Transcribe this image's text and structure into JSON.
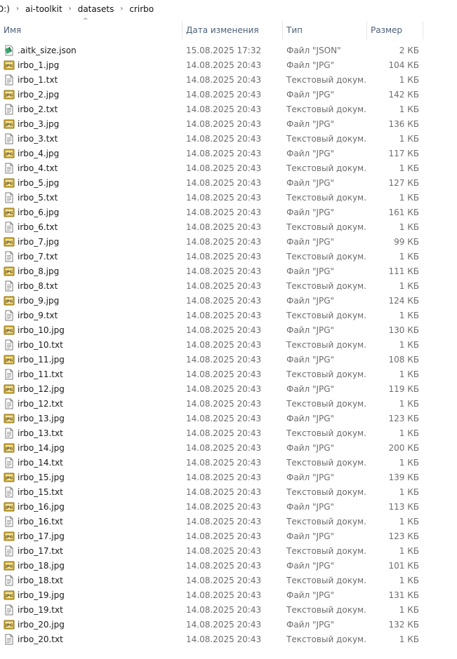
{
  "breadcrumb": {
    "items": [
      "D:)",
      "ai-toolkit",
      "datasets",
      "crirbo"
    ],
    "separator": "›"
  },
  "columns": {
    "name": "Имя",
    "date": "Дата изменения",
    "type": "Тип",
    "size": "Размер",
    "sort_indicator": "^"
  },
  "colors": {
    "header_text": "#4c607a",
    "detail_text": "#6d6d6d",
    "jpg_icon_bg": "#c8a628",
    "json_icon": "#3aa76d"
  },
  "files": [
    {
      "name": ".aitk_size.json",
      "date": "15.08.2025 17:32",
      "type": "Файл \"JSON\"",
      "size": "2 КБ",
      "icon": "json-file-icon"
    },
    {
      "name": "irbo_1.jpg",
      "date": "14.08.2025 20:43",
      "type": "Файл \"JPG\"",
      "size": "104 КБ",
      "icon": "jpg-file-icon"
    },
    {
      "name": "irbo_1.txt",
      "date": "14.08.2025 20:43",
      "type": "Текстовый докум...",
      "size": "1 КБ",
      "icon": "text-file-icon"
    },
    {
      "name": "irbo_2.jpg",
      "date": "14.08.2025 20:43",
      "type": "Файл \"JPG\"",
      "size": "142 КБ",
      "icon": "jpg-file-icon"
    },
    {
      "name": "irbo_2.txt",
      "date": "14.08.2025 20:43",
      "type": "Текстовый докум...",
      "size": "1 КБ",
      "icon": "text-file-icon"
    },
    {
      "name": "irbo_3.jpg",
      "date": "14.08.2025 20:43",
      "type": "Файл \"JPG\"",
      "size": "136 КБ",
      "icon": "jpg-file-icon"
    },
    {
      "name": "irbo_3.txt",
      "date": "14.08.2025 20:43",
      "type": "Текстовый докум...",
      "size": "1 КБ",
      "icon": "text-file-icon"
    },
    {
      "name": "irbo_4.jpg",
      "date": "14.08.2025 20:43",
      "type": "Файл \"JPG\"",
      "size": "117 КБ",
      "icon": "jpg-file-icon"
    },
    {
      "name": "irbo_4.txt",
      "date": "14.08.2025 20:43",
      "type": "Текстовый докум...",
      "size": "1 КБ",
      "icon": "text-file-icon"
    },
    {
      "name": "irbo_5.jpg",
      "date": "14.08.2025 20:43",
      "type": "Файл \"JPG\"",
      "size": "127 КБ",
      "icon": "jpg-file-icon"
    },
    {
      "name": "irbo_5.txt",
      "date": "14.08.2025 20:43",
      "type": "Текстовый докум...",
      "size": "1 КБ",
      "icon": "text-file-icon"
    },
    {
      "name": "irbo_6.jpg",
      "date": "14.08.2025 20:43",
      "type": "Файл \"JPG\"",
      "size": "161 КБ",
      "icon": "jpg-file-icon"
    },
    {
      "name": "irbo_6.txt",
      "date": "14.08.2025 20:43",
      "type": "Текстовый докум...",
      "size": "1 КБ",
      "icon": "text-file-icon"
    },
    {
      "name": "irbo_7.jpg",
      "date": "14.08.2025 20:43",
      "type": "Файл \"JPG\"",
      "size": "99 КБ",
      "icon": "jpg-file-icon"
    },
    {
      "name": "irbo_7.txt",
      "date": "14.08.2025 20:43",
      "type": "Текстовый докум...",
      "size": "1 КБ",
      "icon": "text-file-icon"
    },
    {
      "name": "irbo_8.jpg",
      "date": "14.08.2025 20:43",
      "type": "Файл \"JPG\"",
      "size": "111 КБ",
      "icon": "jpg-file-icon"
    },
    {
      "name": "irbo_8.txt",
      "date": "14.08.2025 20:43",
      "type": "Текстовый докум...",
      "size": "1 КБ",
      "icon": "text-file-icon"
    },
    {
      "name": "irbo_9.jpg",
      "date": "14.08.2025 20:43",
      "type": "Файл \"JPG\"",
      "size": "124 КБ",
      "icon": "jpg-file-icon"
    },
    {
      "name": "irbo_9.txt",
      "date": "14.08.2025 20:43",
      "type": "Текстовый докум...",
      "size": "1 КБ",
      "icon": "text-file-icon"
    },
    {
      "name": "irbo_10.jpg",
      "date": "14.08.2025 20:43",
      "type": "Файл \"JPG\"",
      "size": "130 КБ",
      "icon": "jpg-file-icon"
    },
    {
      "name": "irbo_10.txt",
      "date": "14.08.2025 20:43",
      "type": "Текстовый докум...",
      "size": "1 КБ",
      "icon": "text-file-icon"
    },
    {
      "name": "irbo_11.jpg",
      "date": "14.08.2025 20:43",
      "type": "Файл \"JPG\"",
      "size": "108 КБ",
      "icon": "jpg-file-icon"
    },
    {
      "name": "irbo_11.txt",
      "date": "14.08.2025 20:43",
      "type": "Текстовый докум...",
      "size": "1 КБ",
      "icon": "text-file-icon"
    },
    {
      "name": "irbo_12.jpg",
      "date": "14.08.2025 20:43",
      "type": "Файл \"JPG\"",
      "size": "119 КБ",
      "icon": "jpg-file-icon"
    },
    {
      "name": "irbo_12.txt",
      "date": "14.08.2025 20:43",
      "type": "Текстовый докум...",
      "size": "1 КБ",
      "icon": "text-file-icon"
    },
    {
      "name": "irbo_13.jpg",
      "date": "14.08.2025 20:43",
      "type": "Файл \"JPG\"",
      "size": "123 КБ",
      "icon": "jpg-file-icon"
    },
    {
      "name": "irbo_13.txt",
      "date": "14.08.2025 20:43",
      "type": "Текстовый докум...",
      "size": "1 КБ",
      "icon": "text-file-icon"
    },
    {
      "name": "irbo_14.jpg",
      "date": "14.08.2025 20:43",
      "type": "Файл \"JPG\"",
      "size": "200 КБ",
      "icon": "jpg-file-icon"
    },
    {
      "name": "irbo_14.txt",
      "date": "14.08.2025 20:43",
      "type": "Текстовый докум...",
      "size": "1 КБ",
      "icon": "text-file-icon"
    },
    {
      "name": "irbo_15.jpg",
      "date": "14.08.2025 20:43",
      "type": "Файл \"JPG\"",
      "size": "139 КБ",
      "icon": "jpg-file-icon"
    },
    {
      "name": "irbo_15.txt",
      "date": "14.08.2025 20:43",
      "type": "Текстовый докум...",
      "size": "1 КБ",
      "icon": "text-file-icon"
    },
    {
      "name": "irbo_16.jpg",
      "date": "14.08.2025 20:43",
      "type": "Файл \"JPG\"",
      "size": "113 КБ",
      "icon": "jpg-file-icon"
    },
    {
      "name": "irbo_16.txt",
      "date": "14.08.2025 20:43",
      "type": "Текстовый докум...",
      "size": "1 КБ",
      "icon": "text-file-icon"
    },
    {
      "name": "irbo_17.jpg",
      "date": "14.08.2025 20:43",
      "type": "Файл \"JPG\"",
      "size": "123 КБ",
      "icon": "jpg-file-icon"
    },
    {
      "name": "irbo_17.txt",
      "date": "14.08.2025 20:43",
      "type": "Текстовый докум...",
      "size": "1 КБ",
      "icon": "text-file-icon"
    },
    {
      "name": "irbo_18.jpg",
      "date": "14.08.2025 20:43",
      "type": "Файл \"JPG\"",
      "size": "101 КБ",
      "icon": "jpg-file-icon"
    },
    {
      "name": "irbo_18.txt",
      "date": "14.08.2025 20:43",
      "type": "Текстовый докум...",
      "size": "1 КБ",
      "icon": "text-file-icon"
    },
    {
      "name": "irbo_19.jpg",
      "date": "14.08.2025 20:43",
      "type": "Файл \"JPG\"",
      "size": "131 КБ",
      "icon": "jpg-file-icon"
    },
    {
      "name": "irbo_19.txt",
      "date": "14.08.2025 20:43",
      "type": "Текстовый докум...",
      "size": "1 КБ",
      "icon": "text-file-icon"
    },
    {
      "name": "irbo_20.jpg",
      "date": "14.08.2025 20:43",
      "type": "Файл \"JPG\"",
      "size": "132 КБ",
      "icon": "jpg-file-icon"
    },
    {
      "name": "irbo_20.txt",
      "date": "14.08.2025 20:43",
      "type": "Текстовый докум...",
      "size": "1 КБ",
      "icon": "text-file-icon"
    }
  ]
}
